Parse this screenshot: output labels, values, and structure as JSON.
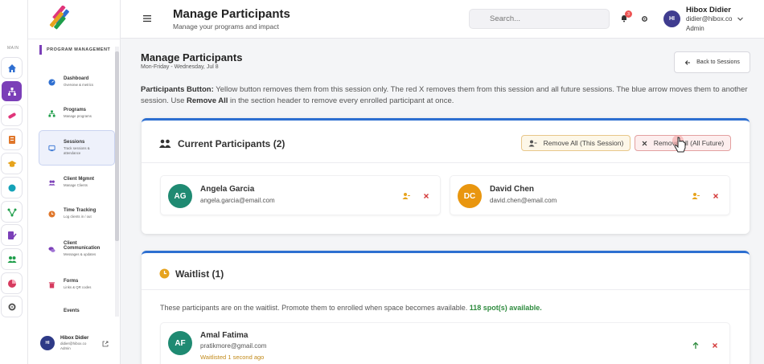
{
  "rail": {
    "label": "MAIN",
    "items": [
      {
        "icon": "home-icon",
        "color": "#2f6fd1"
      },
      {
        "icon": "sitemap-icon",
        "color": "#ffffff"
      },
      {
        "icon": "pill-icon",
        "color": "#e0357a"
      },
      {
        "icon": "checklist-icon",
        "color": "#e0772b"
      },
      {
        "icon": "graduation-cap-icon",
        "color": "#e6a31d"
      },
      {
        "icon": "lightbulb-icon",
        "color": "#14a2b8"
      },
      {
        "icon": "flow-icon",
        "color": "#1e9e4a"
      },
      {
        "icon": "document-edit-icon",
        "color": "#7b3fb8"
      },
      {
        "icon": "users-icon",
        "color": "#1e9e4a"
      },
      {
        "icon": "pie-chart-icon",
        "color": "#d63a5e"
      },
      {
        "icon": "settings-icon",
        "color": "#555555"
      }
    ]
  },
  "sidebar": {
    "section_title": "PROGRAM MANAGEMENT",
    "items": [
      {
        "title": "Dashboard",
        "subtitle": "Overview & metrics",
        "icon": "dashboard-icon"
      },
      {
        "title": "Programs",
        "subtitle": "Manage programs",
        "icon": "sitemap-icon"
      },
      {
        "title": "Sessions",
        "subtitle": "Track sessions & attendance",
        "icon": "sessions-icon"
      },
      {
        "title": "Client Mgmnt",
        "subtitle": "Manage Clients",
        "icon": "users-icon"
      },
      {
        "title": "Time Tracking",
        "subtitle": "Log clients in / out",
        "icon": "clock-icon"
      },
      {
        "title": "Client Communication",
        "subtitle": "Messages & updates",
        "icon": "chat-icon"
      },
      {
        "title": "Forms",
        "subtitle": "Links & QR codes",
        "icon": "trash-icon"
      },
      {
        "title": "Events",
        "subtitle": "",
        "icon": ""
      }
    ],
    "user": {
      "initials": "HI",
      "name": "Hibox Didier",
      "email": "didier@hibox.co",
      "role": "Admin"
    }
  },
  "header": {
    "title": "Manage Participants",
    "subtitle": "Manage your programs and impact",
    "search_placeholder": "Search...",
    "notification_count": "3",
    "user": {
      "initials": "HI",
      "name": "Hibox Didier",
      "email": "didier@hibox.co",
      "role": "Admin"
    }
  },
  "main": {
    "title": "Manage Participants",
    "date": "Mon-Friday - Wednesday, Jul 8",
    "back_label": "Back to Sessions",
    "info": {
      "label": "Participants Button:",
      "text1": " Yellow button removes them from this session only. The red X removes them from this session and all future sessions. The blue arrow moves them to another session. Use ",
      "bold": "Remove All",
      "text2": " in the section header to remove every enrolled participant at once."
    },
    "current": {
      "title": "Current Participants (2)",
      "remove_session_label": "Remove All (This Session)",
      "remove_future_label": "Remove All (All Future)",
      "participants": [
        {
          "initials": "AG",
          "name": "Angela Garcia",
          "email": "angela.garcia@email.com",
          "color": "#1f8a72"
        },
        {
          "initials": "DC",
          "name": "David Chen",
          "email": "david.chen@email.com",
          "color": "#e9960f"
        }
      ]
    },
    "waitlist": {
      "title": "Waitlist (1)",
      "text": "These participants are on the waitlist. Promote them to enrolled when space becomes available. ",
      "spots": "118 spot(s) available.",
      "entries": [
        {
          "initials": "AF",
          "name": "Amal Fatima",
          "email": "pratikmore@gmail.com",
          "status": "Waitlisted 1 second ago",
          "color": "#1f8a72"
        }
      ]
    }
  },
  "colors": {
    "accent": "#2d6fd1",
    "brand": "#7b3fb8",
    "danger": "#d43a3a",
    "warning": "#e6a31d",
    "success": "#2e8b3e"
  }
}
